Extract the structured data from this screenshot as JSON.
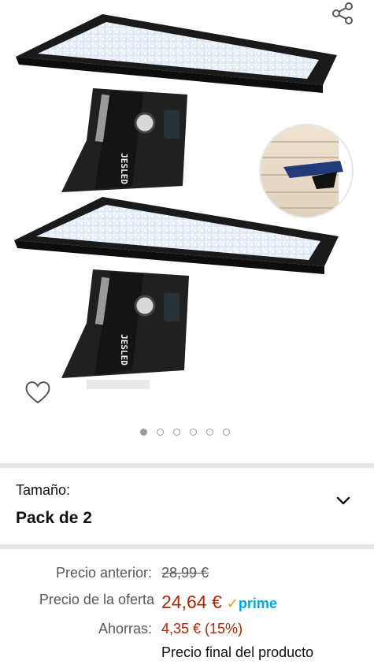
{
  "gallery": {
    "product_brand_mark": "JESLED",
    "icons": {
      "share": "share-icon",
      "favorite": "heart-icon"
    },
    "dots_total": 6,
    "dots_active_index": 0
  },
  "size": {
    "label": "Tamaño:",
    "value": "Pack de 2",
    "expand_icon": "chevron-down-icon"
  },
  "pricing": {
    "previous_label": "Precio anterior:",
    "previous_value": "28,99 €",
    "offer_label": "Precio de la oferta",
    "offer_value": "24,64 €",
    "prime_check": "✓",
    "prime_label": "prime",
    "savings_label": "Ahorras:",
    "savings_value": "4,35 € (15%)",
    "final_note": "Precio final del producto"
  },
  "colors": {
    "deal_red": "#b12704",
    "prime_blue": "#00a8e1",
    "prime_orange": "#ff9900",
    "separator": "#e3e6e6"
  }
}
